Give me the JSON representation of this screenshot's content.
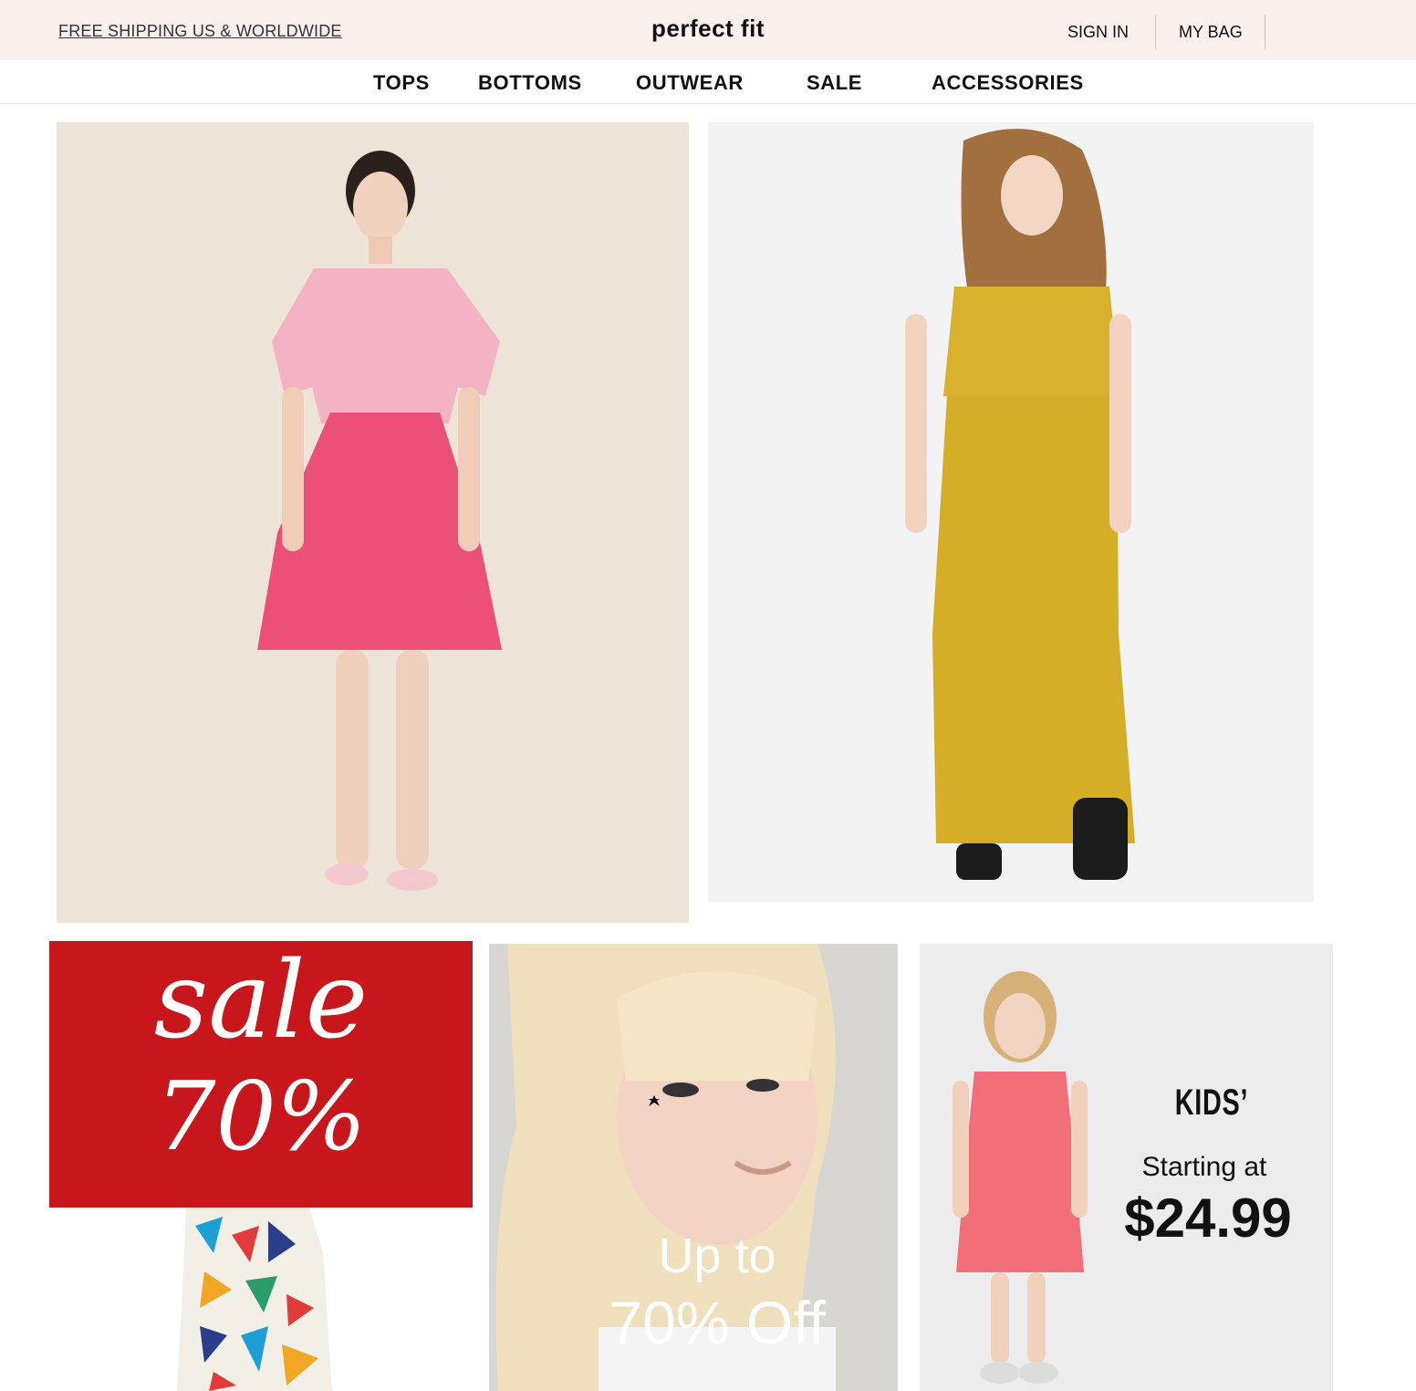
{
  "header": {
    "shipping_link": "FREE SHIPPING US & WORLDWIDE",
    "brand": "perfect fit",
    "sign_in": "SIGN IN",
    "my_bag": "MY BAG"
  },
  "nav": {
    "items": [
      "TOPS",
      "BOTTOMS",
      "OUTWEAR",
      "SALE",
      "ACCESSORIES"
    ]
  },
  "banners": {
    "sale": {
      "word": "sale",
      "percent": "70%"
    },
    "promo": {
      "line1": "Up to",
      "line2": "70% Off"
    },
    "kids": {
      "title": "KIDS’",
      "subtitle": "Starting at",
      "price": "$24.99"
    }
  },
  "colors": {
    "topbar_bg": "#fbf0ec",
    "sale_red": "#c8161d",
    "pink_skirt": "#ec4f78",
    "yellow_dress": "#d9b12a"
  },
  "icons": [
    "model-pink-dress-photo",
    "model-yellow-dress-photo",
    "blonde-model-photo",
    "girl-pink-dress-photo",
    "geometric-dress-photo"
  ]
}
